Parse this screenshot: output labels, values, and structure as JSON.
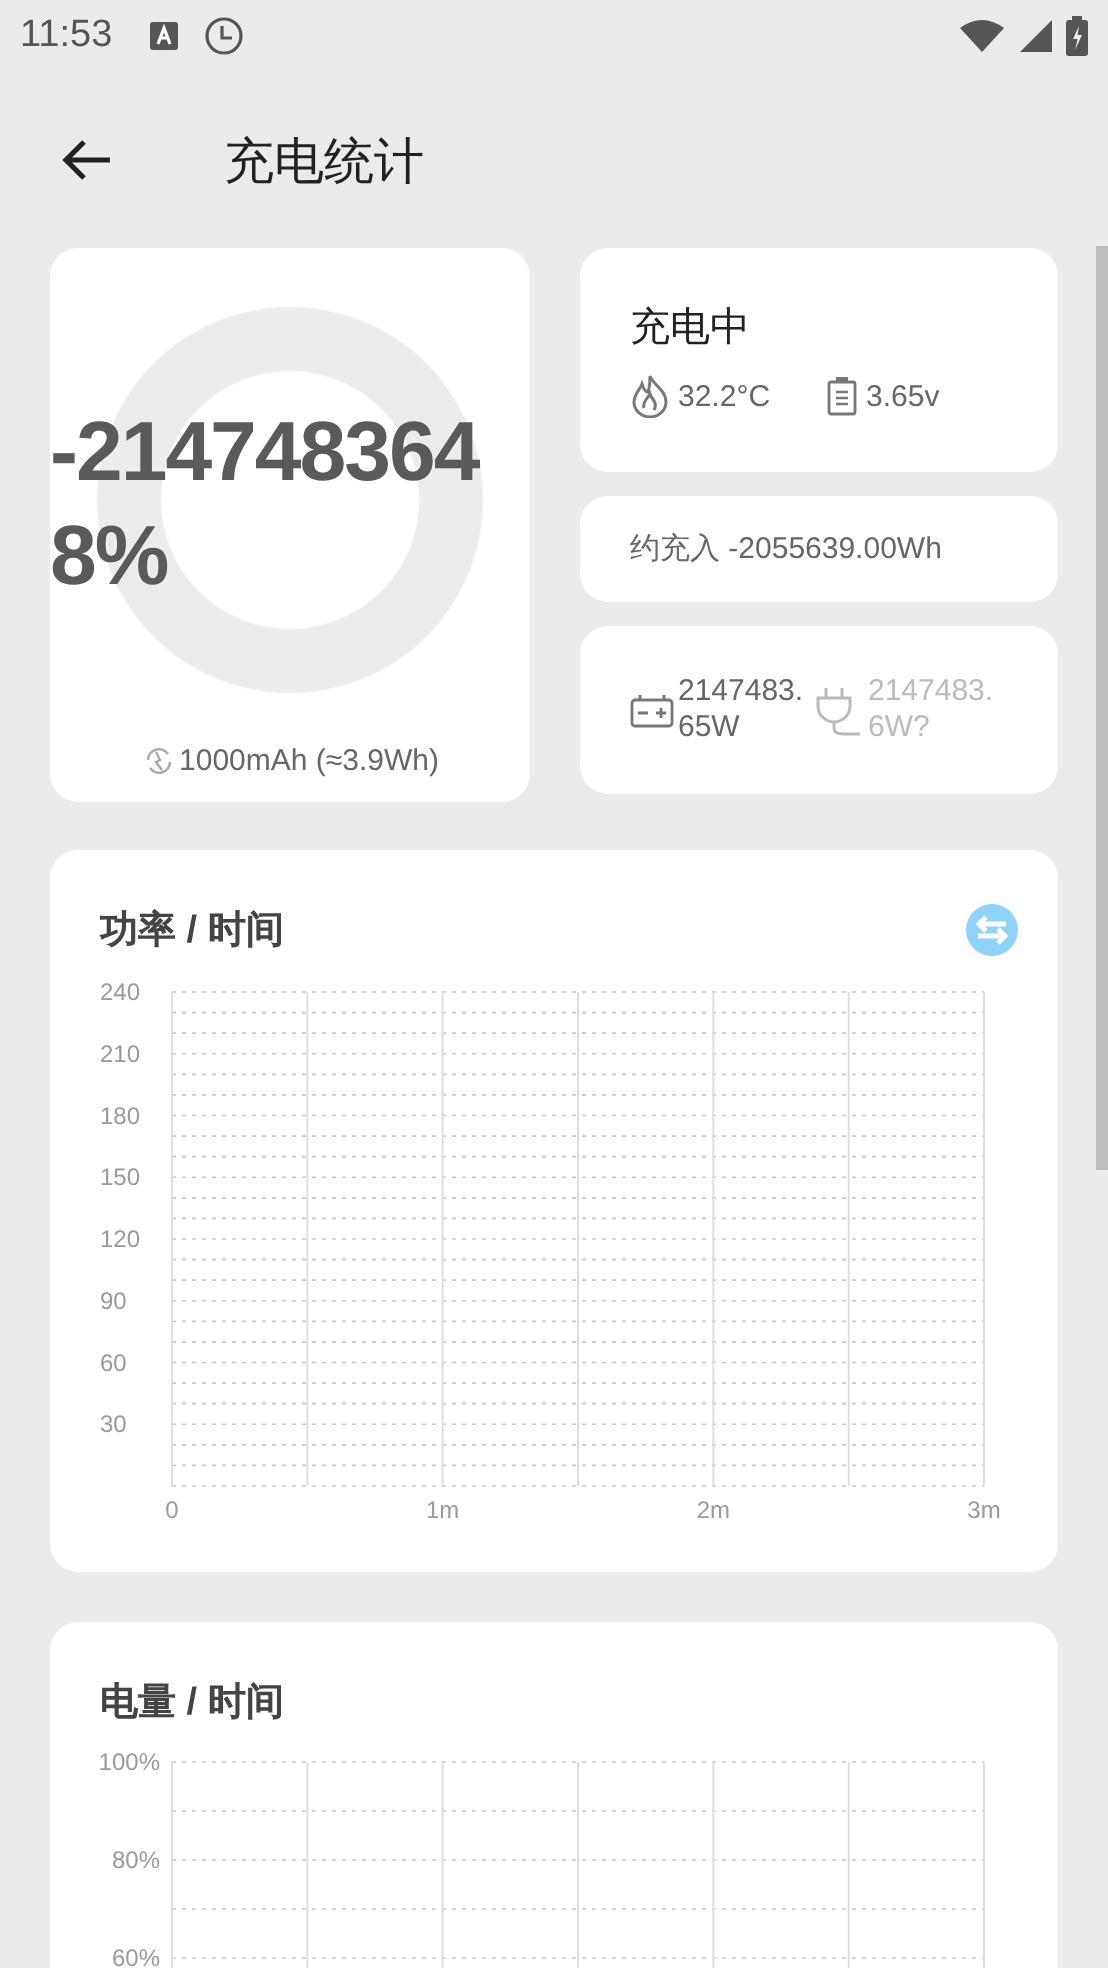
{
  "status_bar": {
    "time": "11:53"
  },
  "header": {
    "title": "充电统计"
  },
  "battery": {
    "percent": "-2147483648%",
    "capacity": "1000mAh (≈3.9Wh)"
  },
  "status": {
    "state": "充电中",
    "temperature": "32.2°C",
    "voltage": "3.65v"
  },
  "energy": {
    "charged": "约充入 -2055639.00Wh"
  },
  "power": [
    {
      "kind": "battery",
      "value": "2147483.65W"
    },
    {
      "kind": "charger",
      "value": "2147483.6W?"
    }
  ],
  "charts": [
    {
      "chart_data": {
        "type": "line",
        "title": "功率 / 时间",
        "grid": true,
        "xlim": [
          0,
          3
        ],
        "ylim": [
          0,
          240
        ],
        "xticks": [
          {
            "value": 0,
            "label": "0"
          },
          {
            "value": 1,
            "label": "1m"
          },
          {
            "value": 2,
            "label": "2m"
          },
          {
            "value": 3,
            "label": "3m"
          }
        ],
        "yticks": [
          30,
          60,
          90,
          120,
          150,
          180,
          210,
          240
        ]
      }
    },
    {
      "chart_data": {
        "type": "line",
        "title": "电量 / 时间",
        "grid": true,
        "xlim": [
          0,
          3
        ],
        "ylim": [
          0,
          100
        ],
        "yticks": [
          {
            "value": 60,
            "label": "60%"
          },
          {
            "value": 80,
            "label": "80%"
          },
          {
            "value": 100,
            "label": "100%"
          }
        ]
      }
    }
  ]
}
